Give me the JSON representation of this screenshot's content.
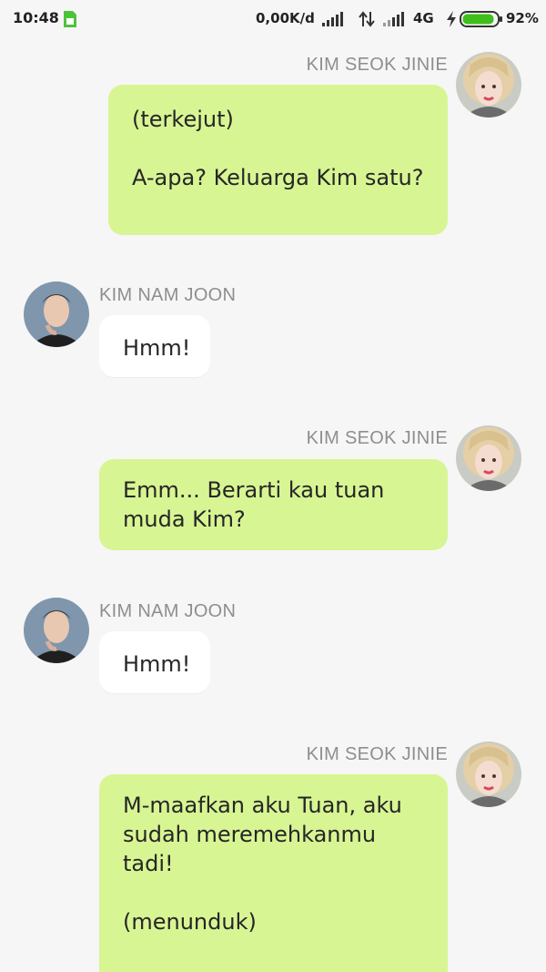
{
  "status_bar": {
    "time": "10:48",
    "net_speed": "0,00K/d",
    "net_type": "4G",
    "battery_percent": "92%",
    "battery_level": 0.92,
    "battery_color": "#3fbe1c"
  },
  "chat": {
    "messages": [
      {
        "sender": "KIM SEOK JINIE",
        "side": "right",
        "lines": [
          "(terkejut)",
          "",
          "A-apa? Keluarga Kim satu?"
        ]
      },
      {
        "sender": "KIM NAM JOON",
        "side": "left",
        "lines": [
          "Hmm!"
        ]
      },
      {
        "sender": "KIM SEOK JINIE",
        "side": "right",
        "lines": [
          "Emm... Berarti kau tuan",
          "muda Kim?"
        ]
      },
      {
        "sender": "KIM NAM JOON",
        "side": "left",
        "lines": [
          "Hmm!"
        ]
      },
      {
        "sender": "KIM SEOK JINIE",
        "side": "right",
        "lines": [
          "M-maafkan aku Tuan, aku",
          "sudah meremehkanmu",
          "tadi!",
          "",
          "(menunduk)"
        ]
      }
    ]
  },
  "colors": {
    "my_bubble": "#d8f593",
    "their_bubble": "#ffffff",
    "background": "#f6f6f6",
    "sender_name": "#8e8e8e"
  }
}
